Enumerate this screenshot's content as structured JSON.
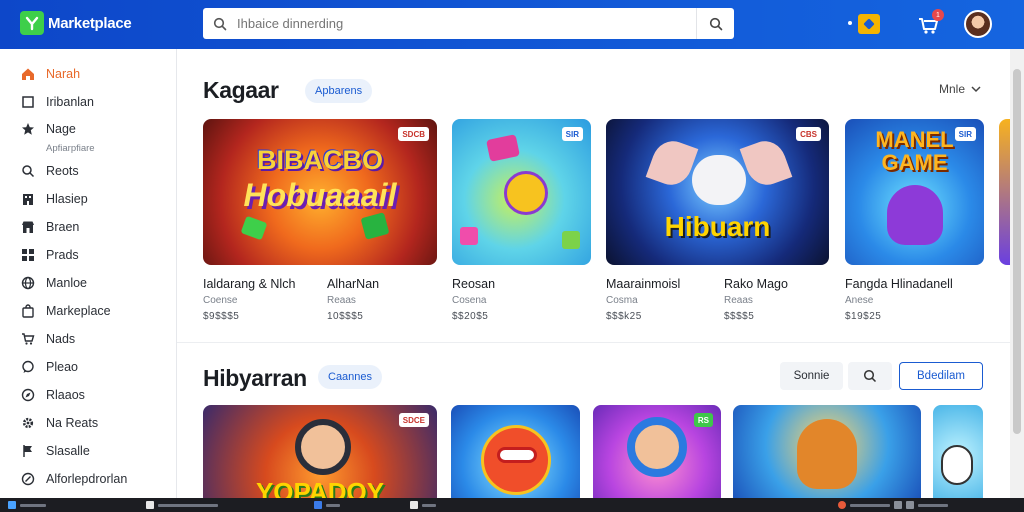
{
  "app": {
    "name": "Marketplace"
  },
  "search": {
    "placeholder": "Ihbaice dinnerding"
  },
  "header": {
    "notification_count": "1"
  },
  "sidebar": {
    "items": [
      {
        "label": "Narah",
        "icon": "home-icon",
        "active": true
      },
      {
        "label": "Iribanlan",
        "icon": "square-icon"
      },
      {
        "label": "Nage",
        "icon": "star-icon",
        "sublabel": "Apfiarpfiare"
      },
      {
        "label": "Reots",
        "icon": "search-icon"
      },
      {
        "label": "Hlasiep",
        "icon": "building-icon"
      },
      {
        "label": "Braen",
        "icon": "store-icon"
      },
      {
        "label": "Prads",
        "icon": "grid-icon"
      },
      {
        "label": "Manloe",
        "icon": "globe-icon"
      },
      {
        "label": "Markeplace",
        "icon": "bag-icon"
      },
      {
        "label": "Nads",
        "icon": "cart-icon"
      },
      {
        "label": "Pleao",
        "icon": "chat-icon"
      },
      {
        "label": "Rlaaos",
        "icon": "compass-icon"
      },
      {
        "label": "Na Reats",
        "icon": "gear-icon"
      },
      {
        "label": "Slasalle",
        "icon": "flag-icon"
      },
      {
        "label": "Alforlepdrorlan",
        "icon": "help-icon"
      }
    ]
  },
  "section1": {
    "title": "Kagaar",
    "chip": "Apbarens",
    "more": "Mnle",
    "cards": [
      {
        "thumb_title": "BIBACBO",
        "thumb_sub": "Hobuaaail",
        "tag": "SDCB",
        "title": "Ialdarang & Nlch",
        "subtitle": "Coense",
        "price": "$9$$$5"
      },
      {
        "thumb_title": "",
        "thumb_sub": "",
        "tag": "SIR",
        "title": "AlharNan",
        "subtitle": "Reaas",
        "price": "10$$$5"
      },
      {
        "thumb_title": "",
        "thumb_sub": "",
        "tag": "",
        "title": "Reosan",
        "subtitle": "Cosena",
        "price": "$$20$5"
      },
      {
        "thumb_title": "",
        "thumb_sub": "Hibuarn",
        "tag": "CBS",
        "title": "Maarainmoisl",
        "subtitle": "Cosma",
        "price": "$$$k25"
      },
      {
        "thumb_title": "",
        "thumb_sub": "",
        "tag": "",
        "title": "Rako Mago",
        "subtitle": "Reaas",
        "price": "$$$$5"
      },
      {
        "thumb_title": "MANEL",
        "thumb_sub": "GAME",
        "tag": "SIR",
        "title": "Fangda Hlinadanell",
        "subtitle": "Anese",
        "price": "$19$25"
      }
    ]
  },
  "section2": {
    "title": "Hibyarran",
    "chip": "Caannes",
    "btn_secondary": "Sonnie",
    "btn_primary": "Bdedilam",
    "cards": [
      {
        "thumb_title": "YOPADOY",
        "tag": "SDCE"
      },
      {
        "thumb_title": "",
        "tag": ""
      },
      {
        "thumb_title": "",
        "tag": "RS"
      },
      {
        "thumb_title": "",
        "tag": ""
      },
      {
        "thumb_title": "",
        "tag": ""
      }
    ]
  }
}
